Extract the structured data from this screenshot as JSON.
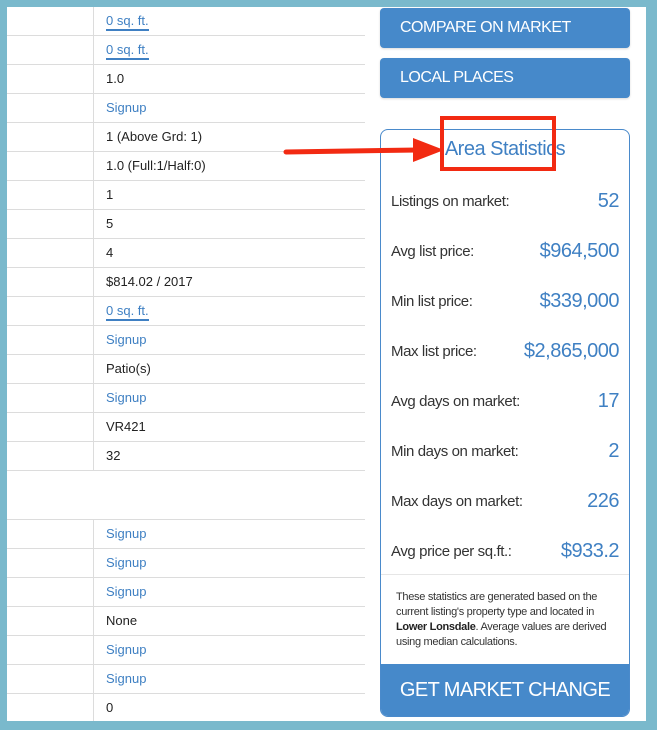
{
  "table": {
    "rows": [
      {
        "value": "0 sq. ft.",
        "kind": "link-underlined"
      },
      {
        "value": "0 sq. ft.",
        "kind": "link-underlined"
      },
      {
        "value": "1.0",
        "kind": "text"
      },
      {
        "value": "Signup",
        "kind": "link"
      },
      {
        "value": "1 (Above Grd: 1)",
        "kind": "text"
      },
      {
        "value": "1.0 (Full:1/Half:0)",
        "kind": "text"
      },
      {
        "value": "1",
        "kind": "text"
      },
      {
        "value": "5",
        "kind": "text"
      },
      {
        "value": "4",
        "kind": "text"
      },
      {
        "value": "$814.02 / 2017",
        "kind": "text"
      },
      {
        "value": "0 sq. ft.",
        "kind": "link-underlined"
      },
      {
        "value": "Signup",
        "kind": "link"
      },
      {
        "value": "Patio(s)",
        "kind": "text"
      },
      {
        "value": "Signup",
        "kind": "link"
      },
      {
        "value": "VR421",
        "kind": "text"
      },
      {
        "value": "32",
        "kind": "text"
      }
    ],
    "rows_after_gap": [
      {
        "value": "Signup",
        "kind": "link"
      },
      {
        "value": "Signup",
        "kind": "link"
      },
      {
        "value": "Signup",
        "kind": "link"
      },
      {
        "value": "None",
        "kind": "text"
      },
      {
        "value": "Signup",
        "kind": "link"
      },
      {
        "value": "Signup",
        "kind": "link"
      },
      {
        "value": "0",
        "kind": "text"
      }
    ]
  },
  "buttons": {
    "compare": "COMPARE ON MARKET",
    "local": "LOCAL PLACES"
  },
  "area_stats": {
    "title": "Area Statistics",
    "items": [
      {
        "label": "Listings on market:",
        "value": "52"
      },
      {
        "label": "Avg list price:",
        "value": "$964,500"
      },
      {
        "label": "Min list price:",
        "value": "$339,000"
      },
      {
        "label": "Max list price:",
        "value": "$2,865,000"
      },
      {
        "label": "Avg days on market:",
        "value": "17"
      },
      {
        "label": "Min days on market:",
        "value": "2"
      },
      {
        "label": "Max days on market:",
        "value": "226"
      },
      {
        "label": "Avg price per sq.ft.:",
        "value": "$933.2"
      }
    ],
    "note": {
      "before": "These statistics are generated based on the current listing's property type and located in ",
      "location": "Lower Lonsdale",
      "after": ". Average values are derived using median calculations."
    },
    "alerts_button": "GET MARKET CHANGE ALERTS"
  },
  "colors": {
    "frame": "#7ab9cc",
    "accent": "#4689ca",
    "link": "#3f80c3",
    "annotation": "#f22a12"
  }
}
